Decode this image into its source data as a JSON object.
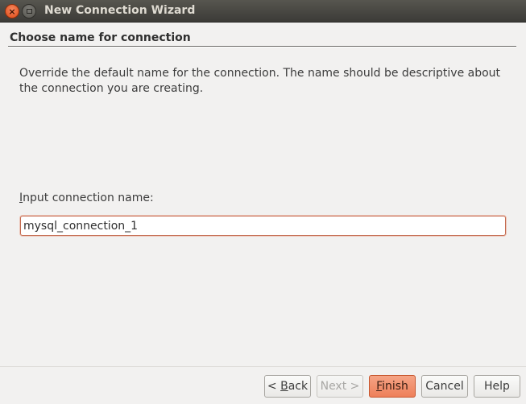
{
  "window": {
    "title": "New Connection Wizard"
  },
  "header": {
    "title": "Choose name for connection"
  },
  "content": {
    "description": "Override the default name for the connection. The name should be descriptive about the connection you are creating.",
    "input_label_mnemonic": "I",
    "input_label_rest": "nput connection name:",
    "input_value": "mysql_connection_1"
  },
  "buttons": {
    "back_prefix": "< ",
    "back_mnemonic": "B",
    "back_rest": "ack",
    "next_label": "Next >",
    "finish_mnemonic": "F",
    "finish_rest": "inish",
    "cancel_label": "Cancel",
    "help_label": "Help"
  },
  "colors": {
    "accent": "#ee7f59",
    "titlebar": "#3c3b37",
    "input_focus_border": "#c46a4f"
  }
}
